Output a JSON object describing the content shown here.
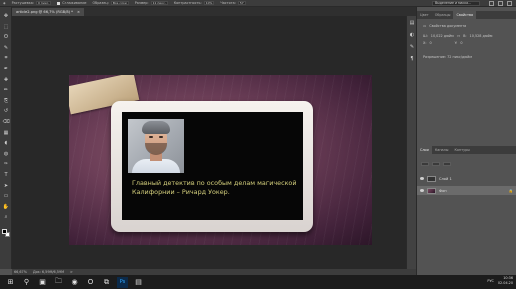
{
  "optionsbar": {
    "fields": [
      {
        "label": "Растушевка:",
        "value": "0 пикс."
      },
      {
        "label": "Сглаживание",
        "value": ""
      },
      {
        "label": "Образец:",
        "value": "Все слои"
      },
      {
        "label": "Размер:",
        "value": "11 пикс."
      },
      {
        "label": "Контрастность:",
        "value": "10%"
      },
      {
        "label": "Частота:",
        "value": "57"
      }
    ],
    "right_field": "Выделение и маска..."
  },
  "document": {
    "tab_title": "article2.png @ 66,7% (RGB/8) *",
    "close_glyph": "×"
  },
  "toolbar": {
    "icons": [
      "move-icon",
      "marquee-icon",
      "lasso-icon",
      "quick-select-icon",
      "crop-icon",
      "eyedropper-icon",
      "healing-icon",
      "brush-icon",
      "stamp-icon",
      "history-brush-icon",
      "eraser-icon",
      "gradient-icon",
      "blur-icon",
      "dodge-icon",
      "pen-icon",
      "type-icon",
      "path-select-icon",
      "shape-icon",
      "hand-icon",
      "zoom-icon"
    ],
    "glyphs": [
      "✥",
      "⬚",
      "ʘ",
      "✎",
      "⌗",
      "✒",
      "✚",
      "✏",
      "⎘",
      "↺",
      "⌫",
      "▦",
      "◖",
      "◍",
      "✑",
      "T",
      "➤",
      "▭",
      "✋",
      "⌕"
    ],
    "fg_color": "#000000",
    "bg_color": "#ffffff"
  },
  "canvas": {
    "caption": "Главный детектив по особым делам магической Калифорнии – Ричард Уокер."
  },
  "status": {
    "zoom": "66,67%",
    "doc_info": "Док: 6,59M/6,59M",
    "arrow": ">"
  },
  "right_panel": {
    "top_tabs": [
      "Цвет",
      "Образцы",
      "Свойства"
    ],
    "active_top_tab": "Свойства",
    "properties": {
      "section": "Свойства документа",
      "w_label": "Ш:",
      "w_value": "10,022 дюйм",
      "h_label": "В:",
      "h_value": "10,528 дюйм",
      "x_label": "X:",
      "x_value": "0",
      "y_label": "Y:",
      "y_value": "0",
      "resolution": "Разрешение: 72 пикс/дюйм"
    },
    "layer_tabs": [
      "Слои",
      "Каналы",
      "Контуры"
    ],
    "active_layer_tab": "Слои",
    "layers": [
      {
        "name": "Слой 1",
        "thumb": "dark"
      },
      {
        "name": "Фон",
        "thumb": "image"
      }
    ]
  },
  "taskbar": {
    "icons": [
      "windows-start-icon",
      "search-icon",
      "task-view-icon",
      "explorer-icon",
      "chrome-icon",
      "opera-icon",
      "vs-icon",
      "photoshop-icon",
      "folder-icon"
    ],
    "glyphs": [
      "⊞",
      "⚲",
      "▣",
      "🗀",
      "◉",
      "O",
      "⧉",
      "Ps",
      "▤"
    ],
    "lang": "РУС",
    "time": "10:36",
    "date": "02.04.20"
  }
}
